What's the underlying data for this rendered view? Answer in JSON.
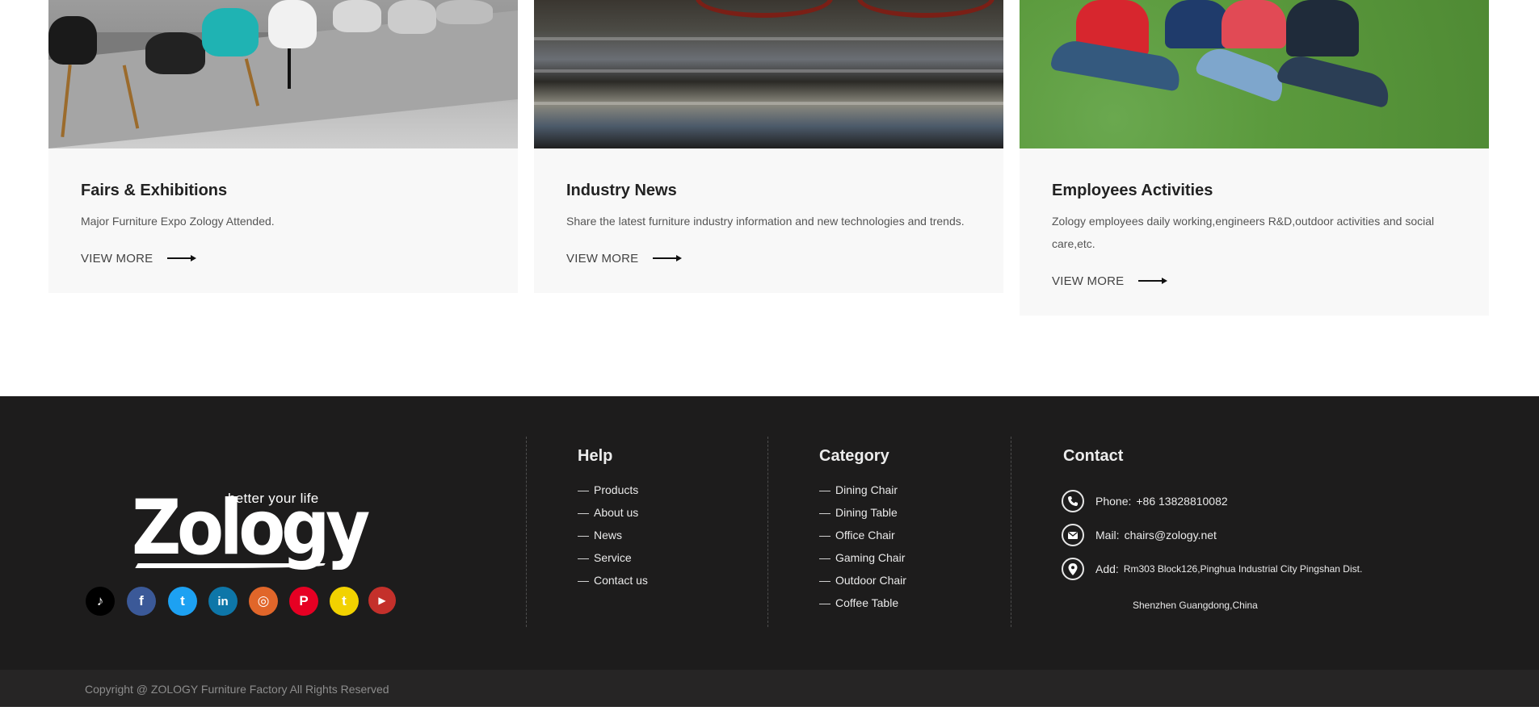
{
  "cards": [
    {
      "title": "Fairs & Exhibitions",
      "desc": "Major Furniture Expo Zology Attended.",
      "more": "VIEW MORE"
    },
    {
      "title": "Industry News",
      "desc": "Share the latest furniture industry information and new technologies and trends.",
      "more": "VIEW MORE"
    },
    {
      "title": "Employees Activities",
      "desc": "Zology employees daily working,engineers R&D,outdoor activities and social care,etc.",
      "more": "VIEW MORE"
    }
  ],
  "footer": {
    "logo": {
      "word": "Zology",
      "tagline": "better your life"
    },
    "social": [
      {
        "icon": "tiktok-icon",
        "glyph": "♪",
        "color": "#000000"
      },
      {
        "icon": "facebook-icon",
        "glyph": "f",
        "color": "#3b5998"
      },
      {
        "icon": "twitter-icon",
        "glyph": "t",
        "color": "#1da1f2"
      },
      {
        "icon": "linkedin-icon",
        "glyph": "in",
        "color": "#0e76a8"
      },
      {
        "icon": "instagram-icon",
        "glyph": "◎",
        "color": "#e1662a"
      },
      {
        "icon": "pinterest-icon",
        "glyph": "P",
        "color": "#e60023"
      },
      {
        "icon": "tumblr-icon",
        "glyph": "t",
        "color": "#f2d200"
      },
      {
        "icon": "youtube-icon",
        "glyph": "▶",
        "color": "#c4302b"
      }
    ],
    "help": {
      "title": "Help",
      "items": [
        "Products",
        "About us",
        "News",
        "Service",
        "Contact us"
      ]
    },
    "category": {
      "title": "Category",
      "items": [
        "Dining Chair",
        "Dining Table",
        "Office Chair",
        "Gaming Chair",
        "Outdoor Chair",
        "Coffee Table"
      ]
    },
    "contact": {
      "title": "Contact",
      "phone_label": "Phone:",
      "phone": "+86 13828810082",
      "mail_label": "Mail:",
      "mail": "chairs@zology.net",
      "add_label": "Add:",
      "address_line1": "Rm303 Block126,Pinghua Industrial City Pingshan Dist.",
      "address_line2": "Shenzhen Guangdong,China"
    },
    "dash": "—",
    "copyright": "Copyright @ ZOLOGY Furniture Factory All Rights Reserved"
  }
}
